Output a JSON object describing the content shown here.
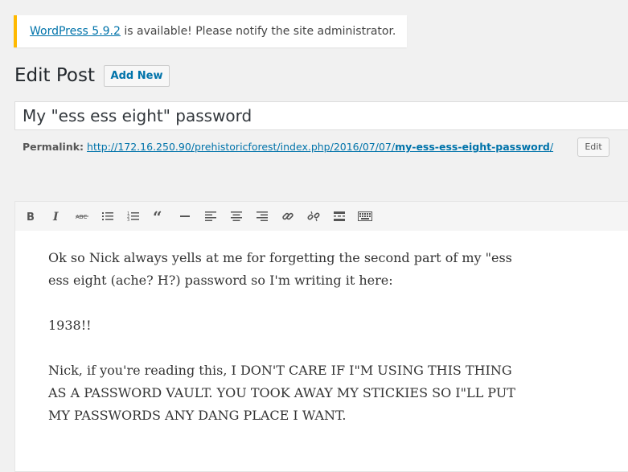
{
  "notice": {
    "link_text": "WordPress 5.9.2",
    "text": " is available! Please notify the site administrator."
  },
  "header": {
    "title": "Edit Post",
    "add_new_label": "Add New"
  },
  "post": {
    "title": "My \"ess ess eight\" password",
    "permalink_label": "Permalink:",
    "permalink_base": "http://172.16.250.90/prehistoricforest/index.php/2016/07/07/",
    "permalink_slug": "my-ess-ess-eight-password",
    "permalink_trail": "/",
    "edit_label": "Edit"
  },
  "toolbar": {
    "buttons": [
      "bold-icon",
      "italic-icon",
      "strikethrough-icon",
      "bulleted-list-icon",
      "numbered-list-icon",
      "blockquote-icon",
      "horizontal-line-icon",
      "align-left-icon",
      "align-center-icon",
      "align-right-icon",
      "insert-link-icon",
      "remove-link-icon",
      "read-more-icon",
      "toolbar-toggle-icon"
    ]
  },
  "content": {
    "paragraphs": [
      "Ok so Nick always yells at me for forgetting the second part of my \"ess\ness eight (ache? H?) password so I'm writing it here:",
      "1938!!",
      "Nick, if you're reading this, I DON'T CARE IF I\"M USING THIS THING\nAS A PASSWORD VAULT. YOU TOOK AWAY MY STICKIES SO I\"LL PUT\nMY PASSWORDS ANY DANG PLACE I WANT."
    ]
  },
  "colors": {
    "link": "#0073aa",
    "notice_border": "#ffb900",
    "background": "#f1f1f1"
  }
}
